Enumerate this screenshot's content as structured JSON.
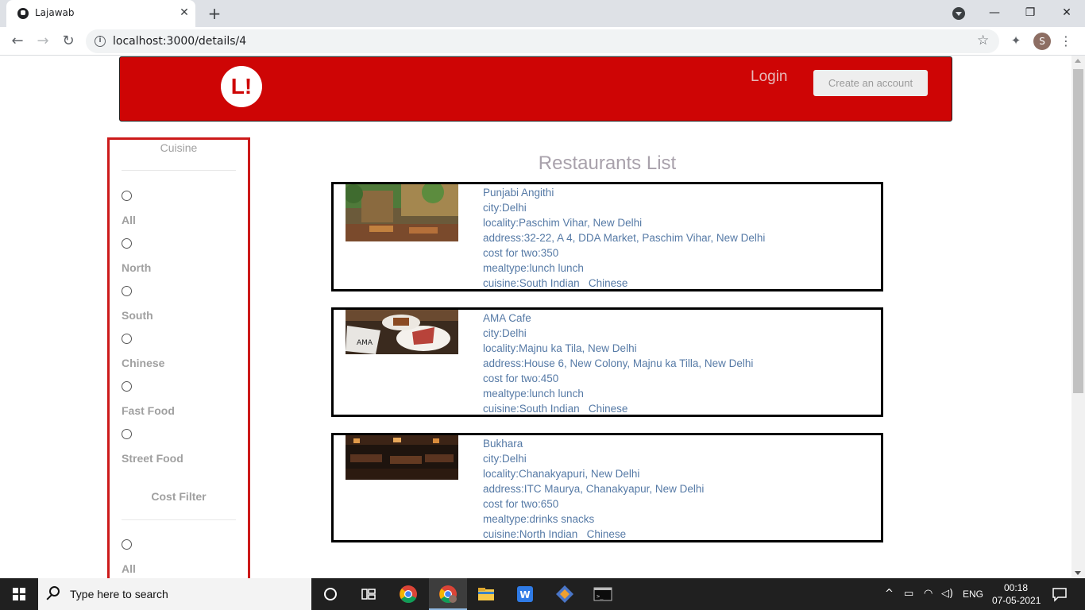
{
  "browser": {
    "tab_title": "Lajawab",
    "tab_close": "✕",
    "new_tab": "+",
    "url": "localhost:3000/details/4",
    "profile_initial": "S",
    "back": "←",
    "forward": "→",
    "reload": "↻",
    "minimize": "—",
    "maximize": "❐",
    "close": "✕",
    "star": "☆",
    "extensions": "✦",
    "menu": "⋮"
  },
  "header": {
    "logo_text": "L!",
    "login_label": "Login",
    "create_account_label": "Create an account",
    "brand_color": "#ce0505"
  },
  "filters": {
    "cuisine_title": "Cuisine",
    "cuisine_options": [
      "All",
      "North",
      "South",
      "Chinese",
      "Fast Food",
      "Street Food"
    ],
    "cost_title": "Cost Filter",
    "cost_options": [
      "All"
    ]
  },
  "list": {
    "heading": "Restaurants List",
    "restaurants": [
      {
        "name": "Punjabi Angithi",
        "city": "city:Delhi",
        "locality": "locality:Paschim Vihar, New Delhi",
        "address": "address:32-22, A 4, DDA Market, Paschim Vihar, New Delhi",
        "cost": "cost for two:350",
        "mealtype": "mealtype:lunch lunch",
        "cuisine": "cuisine:South Indian   Chinese"
      },
      {
        "name": "AMA Cafe",
        "city": "city:Delhi",
        "locality": "locality:Majnu ka Tila, New Delhi",
        "address": "address:House 6, New Colony, Majnu ka Tilla, New Delhi",
        "cost": "cost for two:450",
        "mealtype": "mealtype:lunch lunch",
        "cuisine": "cuisine:South Indian   Chinese"
      },
      {
        "name": "Bukhara",
        "city": "city:Delhi",
        "locality": "locality:Chanakyapuri, New Delhi",
        "address": "address:ITC Maurya, Chanakyapur, New Delhi",
        "cost": "cost for two:650",
        "mealtype": "mealtype:drinks snacks",
        "cuisine": "cuisine:North Indian   Chinese"
      }
    ]
  },
  "taskbar": {
    "search_placeholder": "Type here to search",
    "language": "ENG",
    "time": "00:18",
    "date": "07-05-2021"
  }
}
